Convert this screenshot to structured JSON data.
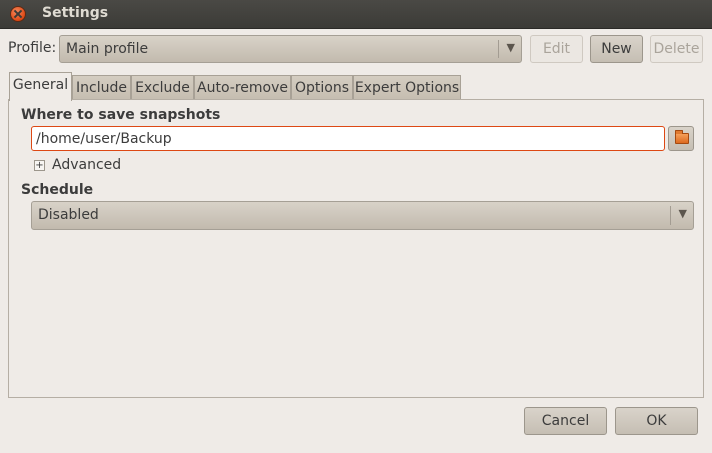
{
  "window": {
    "title": "Settings"
  },
  "profile": {
    "label": "Profile:",
    "selected": "Main profile",
    "edit_label": "Edit",
    "new_label": "New",
    "delete_label": "Delete"
  },
  "tabs": [
    {
      "label": "General",
      "active": true
    },
    {
      "label": "Include"
    },
    {
      "label": "Exclude"
    },
    {
      "label": "Auto-remove"
    },
    {
      "label": "Options"
    },
    {
      "label": "Expert Options"
    }
  ],
  "general": {
    "snapshots_heading": "Where to save snapshots",
    "snapshots_path": "/home/user/Backup",
    "advanced_label": "Advanced",
    "advanced_expander": "+",
    "schedule_heading": "Schedule",
    "schedule_selected": "Disabled"
  },
  "footer": {
    "cancel_label": "Cancel",
    "ok_label": "OK"
  },
  "icons": {
    "close": "close-icon",
    "dropdown": "chevron-down-icon",
    "folder": "folder-icon"
  },
  "colors": {
    "titlebar": "#3c3b37",
    "accent": "#dd4814",
    "window_bg": "#efebe7"
  }
}
